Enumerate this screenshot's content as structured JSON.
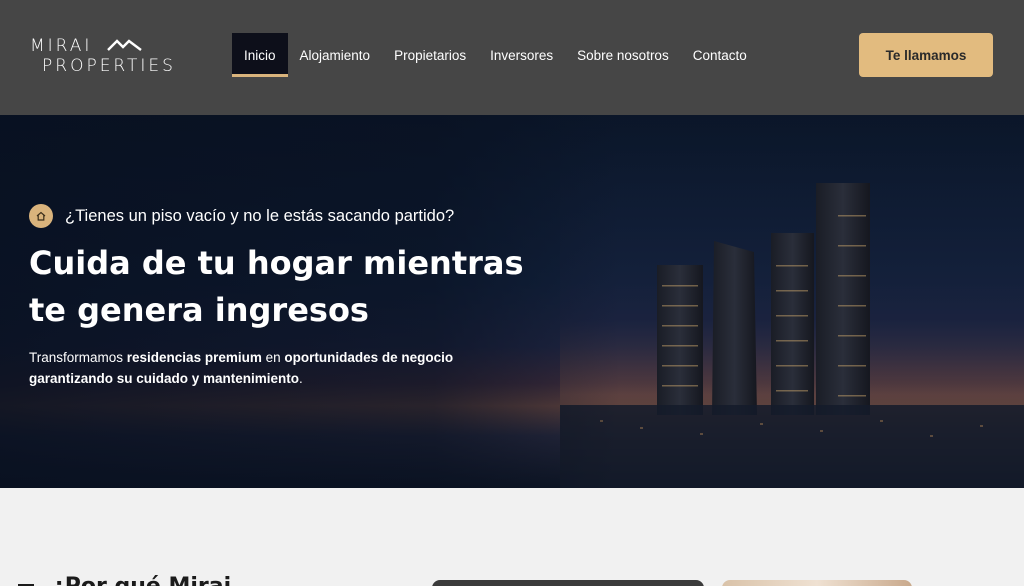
{
  "brand": {
    "logo_line1": "MIRAI",
    "logo_line2": "PROPERTIES",
    "accent_color": "#d9b37c"
  },
  "nav": {
    "items": [
      {
        "label": "Inicio",
        "active": true
      },
      {
        "label": "Alojamiento",
        "active": false
      },
      {
        "label": "Propietarios",
        "active": false
      },
      {
        "label": "Inversores",
        "active": false
      },
      {
        "label": "Sobre nosotros",
        "active": false
      },
      {
        "label": "Contacto",
        "active": false
      }
    ]
  },
  "header": {
    "cta_label": "Te llamamos"
  },
  "hero": {
    "eyebrow_icon": "home-icon",
    "eyebrow": "¿Tienes un piso vacío y no le estás sacando partido?",
    "title_line1": "Cuida de tu hogar mientras",
    "title_line2": "te genera ingresos",
    "desc": {
      "p1": "Transformamos ",
      "b1": "residencias premium",
      "p2": " en ",
      "b2": "oportunidades de negocio garantizando su cuidado y mantenimiento",
      "p3": "."
    }
  },
  "section": {
    "title": "¿Por qué Mirai"
  }
}
